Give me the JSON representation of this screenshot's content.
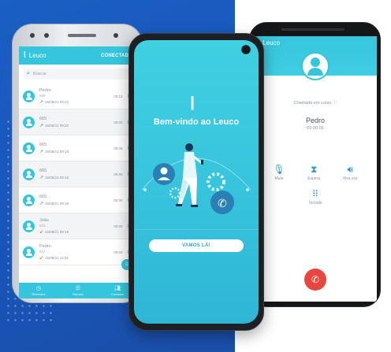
{
  "left_phone": {
    "brand": "Leuco",
    "status": "CONECTADO",
    "search_placeholder": "Buscar",
    "calls": [
      {
        "name": "Pedro",
        "number": "555",
        "date": "15/08/21 09:20",
        "duration": "00:13",
        "type": "outgoing"
      },
      {
        "name": "665",
        "number": "",
        "date": "15/08/21 09:20",
        "duration": "00:00",
        "type": "outgoing"
      },
      {
        "name": "665",
        "number": "",
        "date": "15/08/21 09:19",
        "duration": "00:06",
        "type": "outgoing"
      },
      {
        "name": "665",
        "number": "",
        "date": "15/08/21 09:19",
        "duration": "00:00",
        "type": "outgoing"
      },
      {
        "name": "665",
        "number": "",
        "date": "15/08/21 09:19",
        "duration": "00:00",
        "type": "outgoing"
      },
      {
        "name": "João",
        "number": "515",
        "date": "15/08/21 09:18",
        "duration": "00:00",
        "type": "missed"
      },
      {
        "name": "Pedro",
        "number": "512",
        "date": "15/08/21 14:51",
        "duration": "00:00",
        "type": "missed"
      }
    ],
    "tabs": [
      {
        "label": "Recentes",
        "icon": "clock-icon"
      },
      {
        "label": "Ramais",
        "icon": "list-icon"
      },
      {
        "label": "Contatos",
        "icon": "contacts-icon"
      }
    ]
  },
  "middle_phone": {
    "title": "Bem-vindo ao Leuco",
    "cta": "VAMOS LÁ!"
  },
  "right_phone": {
    "brand": "Leuco",
    "status_text": "Chamada em curso",
    "caller": "Pedro",
    "timer": "00:00:05",
    "actions": [
      {
        "label": "Mute",
        "icon": "mic-off-icon"
      },
      {
        "label": "Espera",
        "icon": "hourglass-icon"
      },
      {
        "label": "Viva voz",
        "icon": "speaker-icon"
      }
    ],
    "keypad_label": "Teclado"
  },
  "colors": {
    "accent": "#35c6dd",
    "background_blue": "#1a5fc4",
    "hangup": "#e8473f"
  }
}
